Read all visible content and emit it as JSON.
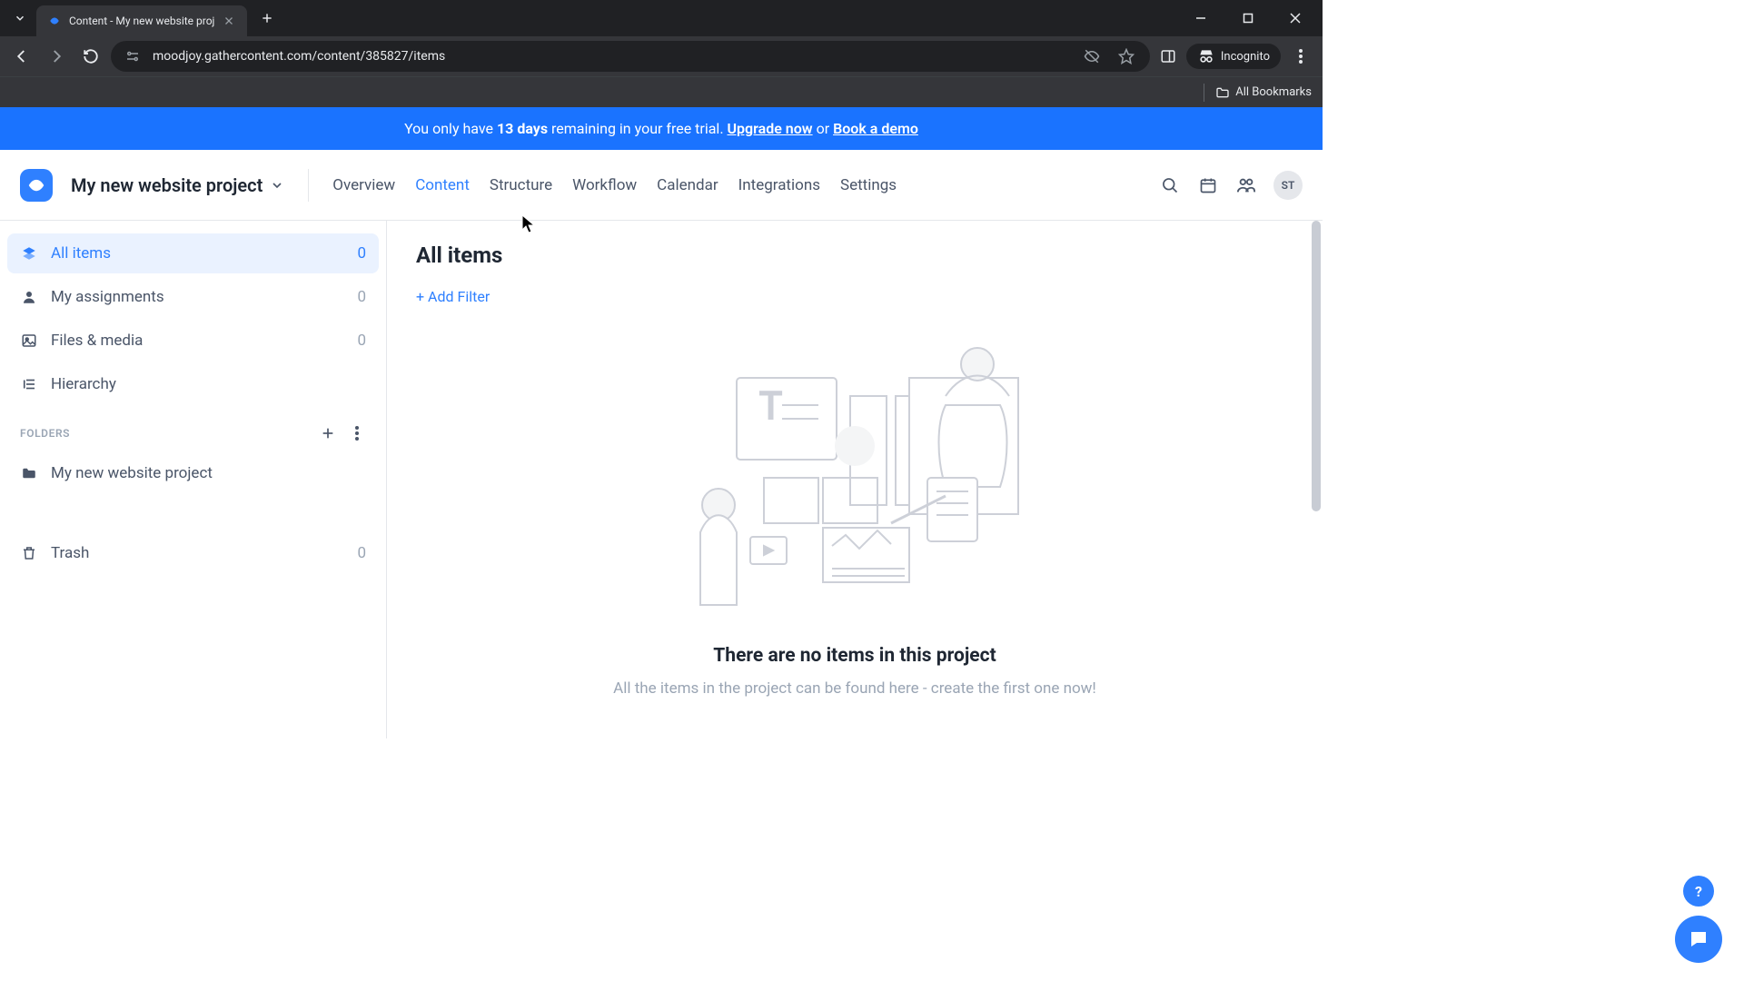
{
  "browser": {
    "tab_title": "Content - My new website proj",
    "url": "moodjoy.gathercontent.com/content/385827/items",
    "incognito_label": "Incognito",
    "all_bookmarks": "All Bookmarks"
  },
  "banner": {
    "prefix": "You only have ",
    "days": "13 days",
    "middle": " remaining in your free trial. ",
    "upgrade": "Upgrade now",
    "or": " or ",
    "demo": "Book a demo"
  },
  "header": {
    "project_name": "My new website project",
    "tabs": [
      "Overview",
      "Content",
      "Structure",
      "Workflow",
      "Calendar",
      "Integrations",
      "Settings"
    ],
    "active_tab_index": 1,
    "avatar": "ST"
  },
  "sidebar": {
    "items": [
      {
        "label": "All items",
        "count": "0",
        "icon": "stack",
        "active": true
      },
      {
        "label": "My assignments",
        "count": "0",
        "icon": "person",
        "active": false
      },
      {
        "label": "Files & media",
        "count": "0",
        "icon": "image",
        "active": false
      },
      {
        "label": "Hierarchy",
        "count": "",
        "icon": "hierarchy",
        "active": false
      }
    ],
    "folders_label": "FOLDERS",
    "folders": [
      {
        "label": "My new website project"
      }
    ],
    "trash": {
      "label": "Trash",
      "count": "0"
    }
  },
  "main": {
    "title": "All items",
    "add_filter": "+ Add Filter",
    "empty_title": "There are no items in this project",
    "empty_sub": "All the items in the project can be found here - create the first one now!"
  },
  "fab": {
    "help": "?"
  }
}
